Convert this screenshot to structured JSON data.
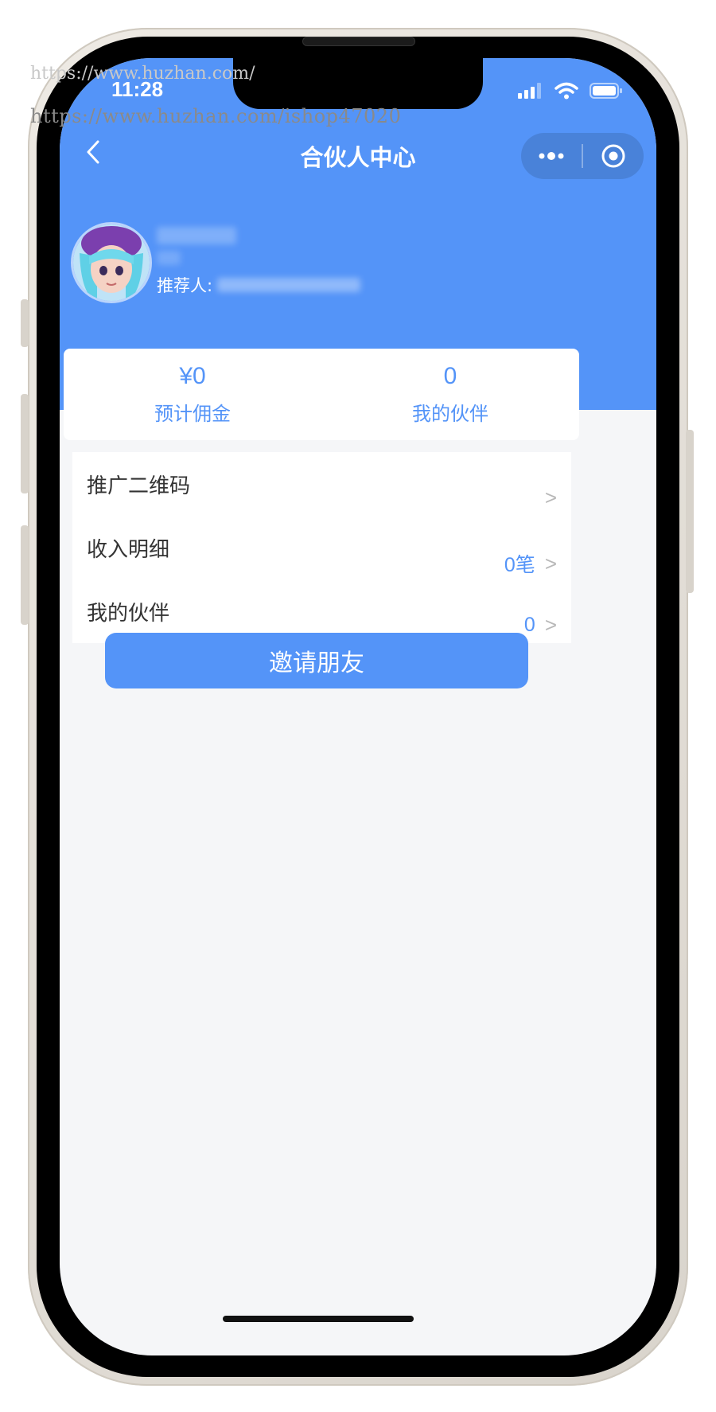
{
  "watermark": {
    "url": "https://www.huzhan.com/ishop47020",
    "faint": "https://www.huzhan.com/"
  },
  "status_bar": {
    "time": "11:28",
    "icons": [
      "signal-icon",
      "wifi-icon",
      "battery-icon"
    ]
  },
  "nav": {
    "back_icon": "chevron-left-icon",
    "title": "合伙人中心",
    "more_icon": "more-dots-icon",
    "close_icon": "target-circle-icon"
  },
  "user": {
    "avatar_icon": "avatar-icon",
    "referrer_label": "推荐人:"
  },
  "stats": [
    {
      "value": "¥0",
      "label": "预计佣金"
    },
    {
      "value": "0",
      "label": "我的伙伴"
    }
  ],
  "menu": [
    {
      "label": "推广二维码",
      "value": "",
      "arrow": ">"
    },
    {
      "label": "收入明细",
      "value": "0笔",
      "arrow": ">"
    },
    {
      "label": "我的伙伴",
      "value": "0",
      "arrow": ">"
    }
  ],
  "invite_button": "邀请朋友",
  "colors": {
    "primary": "#5494f8",
    "background": "#f5f6f8",
    "text": "#333333"
  }
}
